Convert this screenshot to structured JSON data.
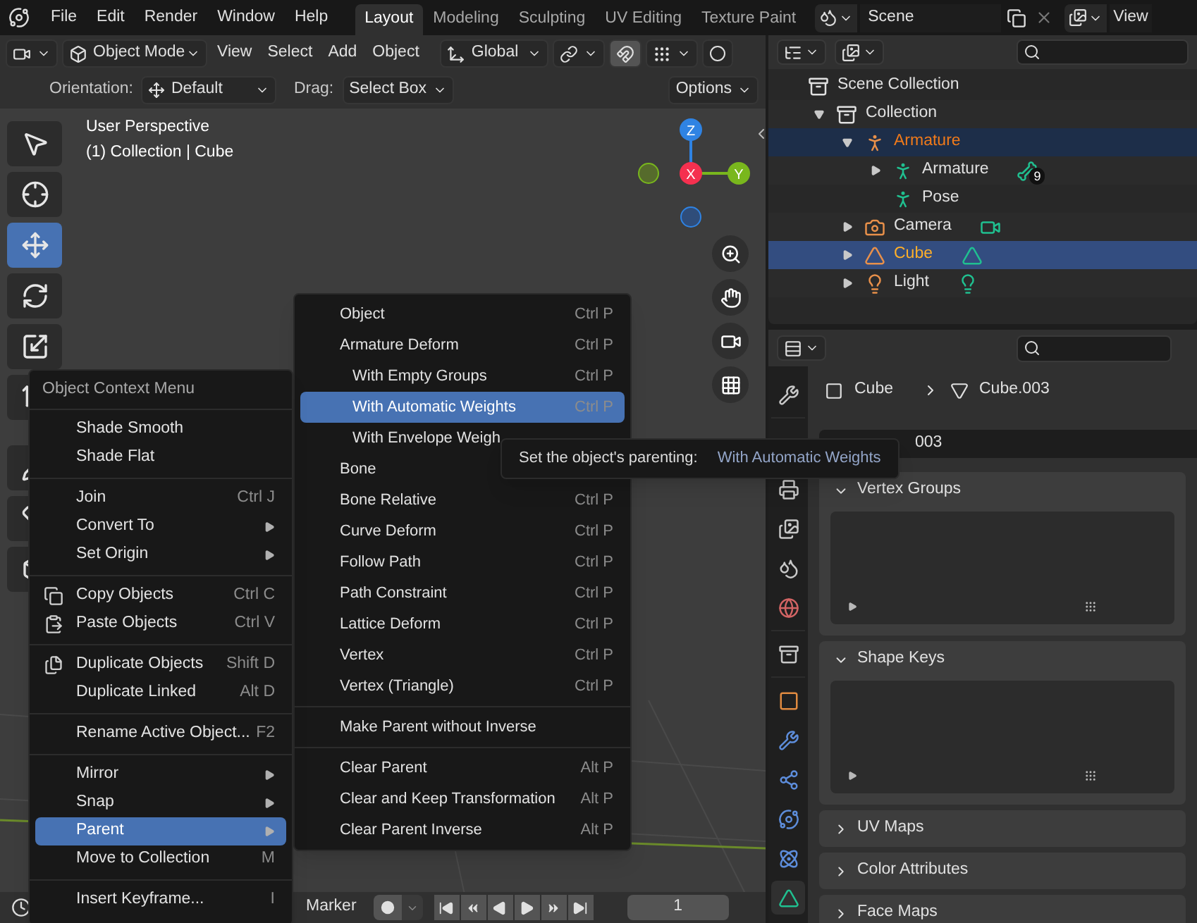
{
  "menubar": [
    "File",
    "Edit",
    "Render",
    "Window",
    "Help"
  ],
  "workspaces": [
    {
      "label": "Layout",
      "selected": true
    },
    {
      "label": "Modeling",
      "selected": false
    },
    {
      "label": "Sculpting",
      "selected": false
    },
    {
      "label": "UV Editing",
      "selected": false
    },
    {
      "label": "Texture Paint",
      "selected": false
    }
  ],
  "scene": {
    "name": "Scene",
    "view_layer": "View"
  },
  "viewport_header": {
    "mode": "Object Mode",
    "menus": [
      "View",
      "Select",
      "Add",
      "Object"
    ],
    "orientation": "Global"
  },
  "tool_settings": {
    "orientation_label": "Orientation:",
    "orientation": "Default",
    "drag_label": "Drag:",
    "drag": "Select Box",
    "options": "Options"
  },
  "viewport": {
    "info": [
      "User Perspective",
      "(1) Collection | Cube"
    ],
    "axes": [
      {
        "label": "Z",
        "color": "#2f83e3"
      },
      {
        "label": "X",
        "color": "#f5304f"
      },
      {
        "label": "Y",
        "color": "#79b71d"
      }
    ]
  },
  "toolbar": [
    {
      "kind": "select_box",
      "selected": false
    },
    {
      "kind": "cursor",
      "selected": false
    },
    {
      "kind": "move",
      "selected": true
    },
    {
      "kind": "rotate",
      "selected": false
    },
    {
      "kind": "scale",
      "selected": false
    },
    {
      "kind": "transform",
      "selected": false
    },
    {
      "kind": "annotate",
      "selected": false
    },
    {
      "kind": "measure",
      "selected": false
    },
    {
      "kind": "add",
      "selected": false
    }
  ],
  "context_menu": {
    "title": "Object Context Menu",
    "groups": [
      {
        "items": [
          {
            "label": "Shade Smooth",
            "kind": "action",
            "selected": false
          },
          {
            "label": "Shade Flat",
            "kind": "action",
            "selected": false
          }
        ]
      },
      {
        "items": [
          {
            "label": "Join",
            "shortcut": "Ctrl J",
            "kind": "action",
            "selected": false
          },
          {
            "label": "Convert To",
            "kind": "submenu",
            "selected": false
          },
          {
            "label": "Set Origin",
            "kind": "submenu",
            "selected": false
          }
        ]
      },
      {
        "items": [
          {
            "label": "Copy Objects",
            "shortcut": "Ctrl C",
            "kind": "copy",
            "selected": false
          },
          {
            "label": "Paste Objects",
            "shortcut": "Ctrl V",
            "kind": "paste",
            "selected": false
          }
        ]
      },
      {
        "items": [
          {
            "label": "Duplicate Objects",
            "shortcut": "Shift D",
            "kind": "duplicate",
            "selected": false
          },
          {
            "label": "Duplicate Linked",
            "shortcut": "Alt D",
            "kind": "action",
            "selected": false
          }
        ]
      },
      {
        "items": [
          {
            "label": "Rename Active Object...",
            "shortcut": "F2",
            "kind": "action",
            "selected": false
          }
        ]
      },
      {
        "items": [
          {
            "label": "Mirror",
            "kind": "submenu",
            "selected": false
          },
          {
            "label": "Snap",
            "kind": "submenu",
            "selected": false
          },
          {
            "label": "Parent",
            "kind": "submenu",
            "selected": true
          },
          {
            "label": "Move to Collection",
            "shortcut": "M",
            "kind": "action",
            "selected": false
          }
        ]
      },
      {
        "items": [
          {
            "label": "Insert Keyframe...",
            "shortcut": "I",
            "kind": "action",
            "selected": false
          }
        ]
      }
    ]
  },
  "parent_menu": {
    "groups": [
      {
        "items": [
          {
            "label": "Object",
            "shortcut": "Ctrl P",
            "selected": false
          },
          {
            "label": "Armature Deform",
            "shortcut": "Ctrl P",
            "selected": false,
            "children": [
              {
                "label": "With Empty Groups",
                "shortcut": "Ctrl P",
                "selected": false
              },
              {
                "label": "With Automatic Weights",
                "shortcut": "Ctrl P",
                "selected": true
              },
              {
                "label": "With Envelope Weigh",
                "selected": false
              }
            ]
          },
          {
            "label": "Bone",
            "selected": false
          },
          {
            "label": "Bone Relative",
            "shortcut": "Ctrl P",
            "selected": false
          },
          {
            "label": "Curve Deform",
            "shortcut": "Ctrl P",
            "selected": false
          },
          {
            "label": "Follow Path",
            "shortcut": "Ctrl P",
            "selected": false
          },
          {
            "label": "Path Constraint",
            "shortcut": "Ctrl P",
            "selected": false
          },
          {
            "label": "Lattice Deform",
            "shortcut": "Ctrl P",
            "selected": false
          },
          {
            "label": "Vertex",
            "shortcut": "Ctrl P",
            "selected": false
          },
          {
            "label": "Vertex (Triangle)",
            "shortcut": "Ctrl P",
            "selected": false
          }
        ]
      },
      {
        "items": [
          {
            "label": "Make Parent without Inverse",
            "selected": false
          }
        ]
      },
      {
        "items": [
          {
            "label": "Clear Parent",
            "shortcut": "Alt P",
            "selected": false
          },
          {
            "label": "Clear and Keep Transformation",
            "shortcut": "Alt P",
            "selected": false
          },
          {
            "label": "Clear Parent Inverse",
            "shortcut": "Alt P",
            "selected": false
          }
        ]
      }
    ]
  },
  "tooltip": {
    "text": "Set the object's parenting:",
    "value": "With Automatic Weights"
  },
  "timeline": {
    "marker": "Marker",
    "frame": "1"
  },
  "outliner": {
    "tree": [
      {
        "label": "Scene Collection",
        "kind": "scene_collection",
        "selected": false,
        "active": false,
        "children": [
          {
            "label": "Collection",
            "kind": "collection",
            "expanded": true,
            "selected": false,
            "active": false,
            "children": [
              {
                "label": "Armature",
                "kind": "armature",
                "expanded": true,
                "selected": true,
                "active": false,
                "children": [
                  {
                    "label": "Armature",
                    "kind": "armature_data",
                    "expanded": false,
                    "selected": false,
                    "active": false,
                    "badge": "9"
                  },
                  {
                    "label": "Pose",
                    "kind": "pose",
                    "selected": false,
                    "active": false
                  }
                ]
              },
              {
                "label": "Camera",
                "kind": "camera",
                "expanded": false,
                "selected": false,
                "active": false
              },
              {
                "label": "Cube",
                "kind": "mesh",
                "expanded": false,
                "selected": true,
                "active": true
              },
              {
                "label": "Light",
                "kind": "light",
                "expanded": false,
                "selected": false,
                "active": false
              }
            ]
          }
        ]
      }
    ]
  },
  "properties": {
    "tabs": [
      {
        "kind": "tool",
        "selected": false
      },
      {
        "kind": "output",
        "selected": false
      },
      {
        "kind": "view_layer",
        "selected": false
      },
      {
        "kind": "scene",
        "selected": false
      },
      {
        "kind": "world",
        "selected": false
      },
      {
        "kind": "collection",
        "selected": false
      },
      {
        "kind": "object",
        "selected": false
      },
      {
        "kind": "modifiers",
        "selected": false
      },
      {
        "kind": "particles",
        "selected": false
      },
      {
        "kind": "physics",
        "selected": false
      },
      {
        "kind": "constraints",
        "selected": false
      },
      {
        "kind": "data",
        "selected": true
      }
    ],
    "breadcrumb": [
      "Cube",
      "Cube.003"
    ],
    "mesh_name": "003",
    "panels": [
      {
        "title": "Vertex Groups",
        "expanded": true
      },
      {
        "title": "Shape Keys",
        "expanded": true
      },
      {
        "title": "UV Maps",
        "expanded": false
      },
      {
        "title": "Color Attributes",
        "expanded": false
      },
      {
        "title": "Face Maps",
        "expanded": false
      }
    ]
  }
}
